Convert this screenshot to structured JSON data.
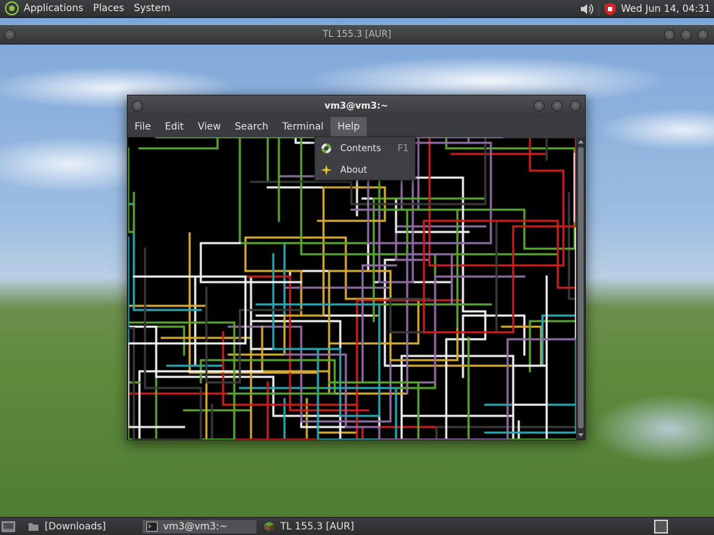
{
  "top_panel": {
    "menus": [
      "Applications",
      "Places",
      "System"
    ],
    "clock": "Wed Jun 14, 04:31"
  },
  "background_window": {
    "title": "TL 155.3 [AUR]"
  },
  "terminal": {
    "title": "vm3@vm3:~",
    "menus": [
      "File",
      "Edit",
      "View",
      "Search",
      "Terminal",
      "Help"
    ],
    "active_menu": "Help",
    "help_menu": {
      "items": [
        {
          "label": "Contents",
          "accel": "F1",
          "icon": "help-lifebuoy-icon"
        },
        {
          "label": "About",
          "accel": "",
          "icon": "about-star-icon"
        }
      ]
    },
    "pipe_colors": [
      "#d4a934",
      "#8e6ca3",
      "#2aa6b0",
      "#f0f0f0",
      "#3a3a3a",
      "#c81e1e",
      "#5aa532"
    ]
  },
  "taskbar": {
    "items": [
      {
        "label": "[Downloads]",
        "icon": "folder-icon",
        "active": false
      },
      {
        "label": "vm3@vm3:~",
        "icon": "terminal-icon",
        "active": true
      },
      {
        "label": "TL 155.3 [AUR]",
        "icon": "minecraft-block-icon",
        "active": false
      }
    ]
  }
}
